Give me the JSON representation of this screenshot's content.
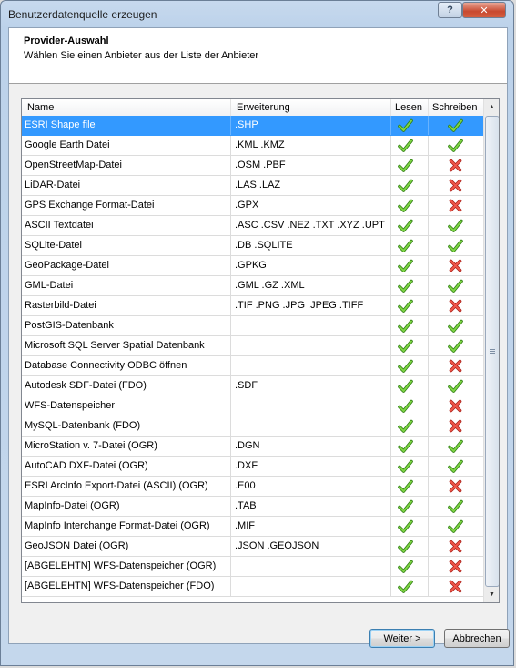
{
  "window": {
    "title": "Benutzerdatenquelle erzeugen",
    "help_label": "?",
    "close_label": "✕"
  },
  "header": {
    "title": "Provider-Auswahl",
    "subtitle": "Wählen Sie einen Anbieter aus der Liste der Anbieter"
  },
  "table": {
    "columns": {
      "name": "Name",
      "ext": "Erweiterung",
      "read": "Lesen",
      "write": "Schreiben"
    },
    "rows": [
      {
        "name": "ESRI Shape file",
        "ext": ".SHP",
        "read": true,
        "write": true,
        "selected": true
      },
      {
        "name": "Google Earth Datei",
        "ext": ".KML .KMZ",
        "read": true,
        "write": true
      },
      {
        "name": "OpenStreetMap-Datei",
        "ext": ".OSM .PBF",
        "read": true,
        "write": false
      },
      {
        "name": "LiDAR-Datei",
        "ext": ".LAS .LAZ",
        "read": true,
        "write": false
      },
      {
        "name": "GPS Exchange Format-Datei",
        "ext": ".GPX",
        "read": true,
        "write": false
      },
      {
        "name": "ASCII Textdatei",
        "ext": ".ASC .CSV .NEZ .TXT .XYZ .UPT",
        "read": true,
        "write": true
      },
      {
        "name": "SQLite-Datei",
        "ext": ".DB .SQLITE",
        "read": true,
        "write": true
      },
      {
        "name": "GeoPackage-Datei",
        "ext": ".GPKG",
        "read": true,
        "write": false
      },
      {
        "name": "GML-Datei",
        "ext": ".GML .GZ .XML",
        "read": true,
        "write": true
      },
      {
        "name": "Rasterbild-Datei",
        "ext": ".TIF .PNG .JPG .JPEG .TIFF",
        "read": true,
        "write": false
      },
      {
        "name": "PostGIS-Datenbank",
        "ext": "",
        "read": true,
        "write": true
      },
      {
        "name": "Microsoft SQL Server Spatial Datenbank",
        "ext": "",
        "read": true,
        "write": true
      },
      {
        "name": "Database Connectivity ODBC öffnen",
        "ext": "",
        "read": true,
        "write": false
      },
      {
        "name": "Autodesk SDF-Datei (FDO)",
        "ext": ".SDF",
        "read": true,
        "write": true
      },
      {
        "name": "WFS-Datenspeicher",
        "ext": "",
        "read": true,
        "write": false
      },
      {
        "name": "MySQL-Datenbank (FDO)",
        "ext": "",
        "read": true,
        "write": false
      },
      {
        "name": "MicroStation v. 7-Datei (OGR)",
        "ext": ".DGN",
        "read": true,
        "write": true
      },
      {
        "name": "AutoCAD DXF-Datei (OGR)",
        "ext": ".DXF",
        "read": true,
        "write": true
      },
      {
        "name": "ESRI ArcInfo Export-Datei (ASCII) (OGR)",
        "ext": ".E00",
        "read": true,
        "write": false
      },
      {
        "name": "MapInfo-Datei (OGR)",
        "ext": ".TAB",
        "read": true,
        "write": true
      },
      {
        "name": "MapInfo Interchange Format-Datei (OGR)",
        "ext": ".MIF",
        "read": true,
        "write": true
      },
      {
        "name": "GeoJSON Datei (OGR)",
        "ext": ".JSON .GEOJSON",
        "read": true,
        "write": false
      },
      {
        "name": "[ABGELEHTN] WFS-Datenspeicher (OGR)",
        "ext": "",
        "read": true,
        "write": false
      },
      {
        "name": "[ABGELEHTN] WFS-Datenspeicher (FDO)",
        "ext": "",
        "read": true,
        "write": false
      }
    ]
  },
  "buttons": {
    "next": "Weiter >",
    "cancel": "Abbrechen"
  },
  "icons": {
    "yes": "green-checkmark-icon",
    "no": "red-cross-icon"
  },
  "colors": {
    "selection": "#3399ff",
    "check": "#4caf20",
    "cross": "#d9342b"
  }
}
